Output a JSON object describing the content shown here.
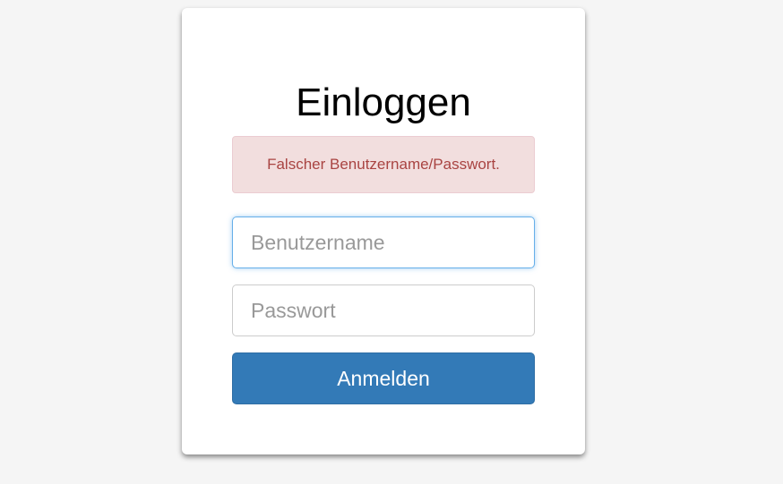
{
  "login": {
    "title": "Einloggen",
    "error_message": "Falscher Benutzername/Passwort.",
    "username": {
      "value": "",
      "placeholder": "Benutzername"
    },
    "password": {
      "value": "",
      "placeholder": "Passwort"
    },
    "submit_label": "Anmelden"
  },
  "colors": {
    "page_background": "#f5f5f5",
    "card_background": "#ffffff",
    "alert_background": "#f2dede",
    "alert_text": "#a94442",
    "button_background": "#337ab7",
    "focus_border": "#66afe9"
  }
}
